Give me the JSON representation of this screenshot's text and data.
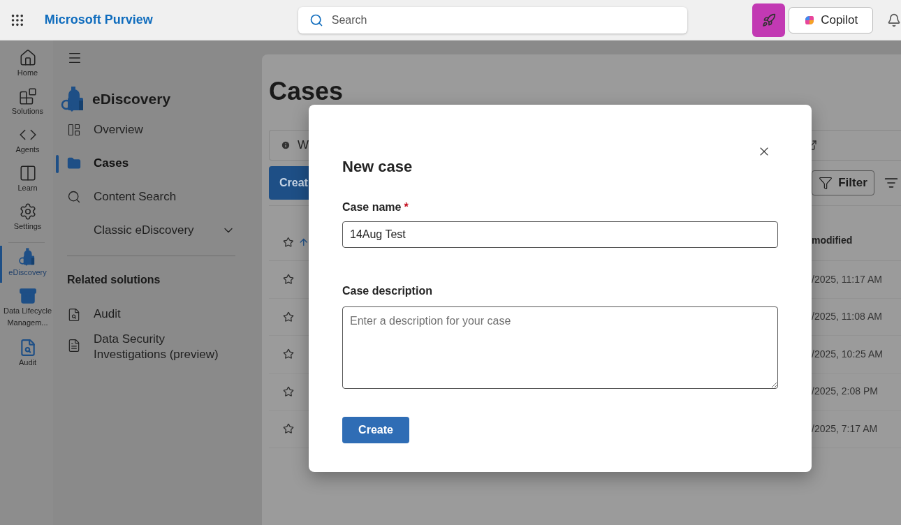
{
  "top_bar": {
    "title": "Microsoft Purview",
    "search": {
      "placeholder": "Search"
    },
    "copilot_button": "Copilot"
  },
  "rail": [
    {
      "label": "Home",
      "selected": false
    },
    {
      "label": "Solutions",
      "selected": false
    },
    {
      "label": "Agents",
      "selected": false
    },
    {
      "label": "Learn",
      "selected": false
    },
    {
      "label": "Settings",
      "selected": false
    },
    {
      "label": "eDiscovery",
      "selected": true
    },
    {
      "label": "Data Lifecycle Managem...",
      "selected": false
    },
    {
      "label": "Audit",
      "selected": false
    }
  ],
  "nav": {
    "title": "eDiscovery",
    "items": [
      {
        "label": "Overview",
        "selected": false
      },
      {
        "label": "Cases",
        "selected": true
      },
      {
        "label": "Content Search",
        "selected": false
      },
      {
        "label": "Classic eDiscovery",
        "selected": false,
        "expanded": false
      }
    ],
    "section": "Related solutions",
    "related": [
      {
        "label": "Audit"
      },
      {
        "label": "Data Security Investigations (preview)"
      }
    ]
  },
  "page": {
    "title": "Cases",
    "info_fragment": "W",
    "create_fragment": "Creat",
    "filter_button": "Filter",
    "column_fragment": "modified",
    "rows": [
      {
        "starred": false,
        "modified_fragment": "/2025, 11:17 AM"
      },
      {
        "starred": false,
        "modified_fragment": "/2025, 11:08 AM"
      },
      {
        "starred": false,
        "modified_fragment": "/2025, 10:25 AM"
      },
      {
        "starred": false,
        "modified_fragment": "/2025, 2:08 PM"
      },
      {
        "starred": false,
        "modified_fragment": "/2025, 7:17 AM"
      }
    ]
  },
  "dialog": {
    "title": "New case",
    "fields": [
      {
        "kind": "input",
        "label": "Case name",
        "required_mark": "*",
        "value": "14Aug Test"
      },
      {
        "kind": "textarea",
        "label": "Case description",
        "placeholder": "Enter a description for your case"
      }
    ],
    "button": "Create"
  }
}
